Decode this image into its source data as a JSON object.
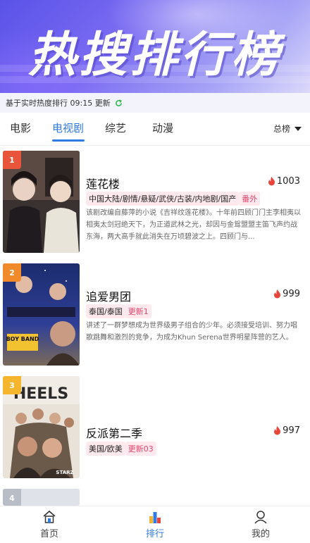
{
  "banner": {
    "title": "热搜排行榜"
  },
  "update": {
    "text": "基于实时热度排行 09:15 更新"
  },
  "tabs": [
    {
      "label": "电影"
    },
    {
      "label": "电视剧"
    },
    {
      "label": "综艺"
    },
    {
      "label": "动漫"
    }
  ],
  "active_tab": "电视剧",
  "sort": {
    "label": "总榜"
  },
  "colors": {
    "accent": "#2f7be6",
    "hot": "#e8456a",
    "rank1": "#e8553b",
    "rank2": "#f08a2a",
    "rank3": "#f5b52c",
    "rank4": "#b9bdc6"
  },
  "items": [
    {
      "rank": "1",
      "title": "莲花楼",
      "heat": "1003",
      "tags": "中国大陆/剧情/悬疑/武侠/古装/内地剧/国产",
      "update": "番外",
      "desc": "该剧改编自藤萍的小说《吉祥纹莲花楼》。十年前四顾门门主李相夷以相夷太剑冠绝天下，为正道武林之光，却因与金鸳盟盟主笛飞声约战东海，两大高手就此消失在万顷碧波之上。四顾门与..."
    },
    {
      "rank": "2",
      "title": "追爱男团",
      "heat": "999",
      "tags": "泰国/泰国",
      "update": "更新1",
      "desc": "讲述了一群梦想成为世界级男子组合的少年。必须接受培训、努力唱歌跳舞和激烈的竞争，为成为Khun Serena世界明星阵营的艺人。"
    },
    {
      "rank": "3",
      "title": "反派第二季",
      "heat": "997",
      "tags": "美国/欧美",
      "update": "更新03",
      "desc": ""
    },
    {
      "rank": "4"
    }
  ],
  "posters": {
    "p2_text": "BOY BAND",
    "p3_text": "HEELS",
    "p3_brand": "STARZ"
  },
  "nav": [
    {
      "label": "首页",
      "icon": "home-icon"
    },
    {
      "label": "排行",
      "icon": "ranking-icon"
    },
    {
      "label": "我的",
      "icon": "profile-icon"
    }
  ]
}
